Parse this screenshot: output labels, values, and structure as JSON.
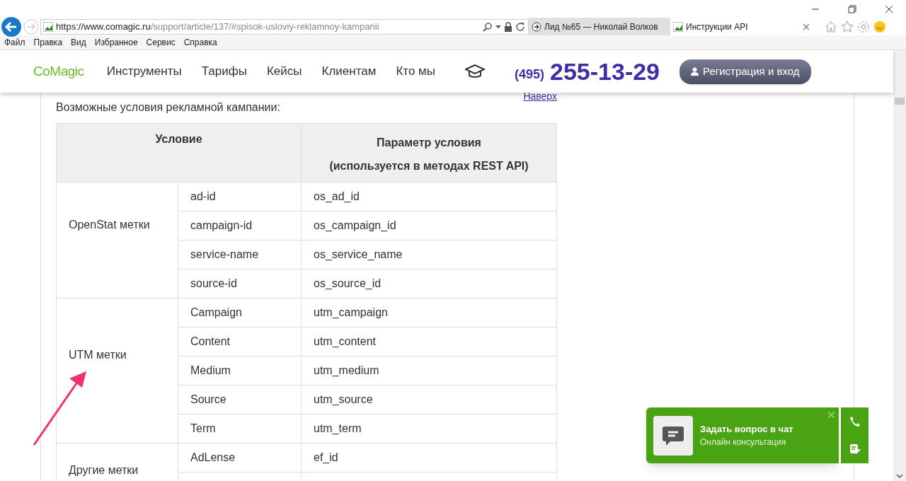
{
  "browser": {
    "url_host": "https://www.comagic.ru",
    "url_path": "/support/article/137/#spisok-usloviy-reklamnoy-kampanii",
    "tabs": [
      {
        "title": "Лид №65 — Николай Волков",
        "selected": false
      },
      {
        "title": "Инструкции API",
        "selected": true
      }
    ],
    "menu": [
      "Файл",
      "Правка",
      "Вид",
      "Избранное",
      "Сервис",
      "Справка"
    ]
  },
  "site": {
    "logo": "CoMagic",
    "nav": [
      "Инструменты",
      "Тарифы",
      "Кейсы",
      "Клиентам",
      "Кто мы"
    ],
    "phone_code": "(495)",
    "phone": "255-13-29",
    "login": "Регистрация и вход"
  },
  "article": {
    "top_link": "Наверх",
    "caption": "Возможные условия рекламной кампании:",
    "table": {
      "columns": [
        "Условие",
        "Параметр условия",
        "(используется в методах REST API)"
      ],
      "groups": [
        {
          "name": "OpenStat метки",
          "rows": [
            [
              "ad-id",
              "os_ad_id"
            ],
            [
              "campaign-id",
              "os_campaign_id"
            ],
            [
              "service-name",
              "os_service_name"
            ],
            [
              "source-id",
              "os_source_id"
            ]
          ]
        },
        {
          "name": "UTM метки",
          "rows": [
            [
              "Campaign",
              "utm_campaign"
            ],
            [
              "Content",
              "utm_content"
            ],
            [
              "Medium",
              "utm_medium"
            ],
            [
              "Source",
              "utm_source"
            ],
            [
              "Term",
              "utm_term"
            ]
          ]
        },
        {
          "name": "Другие метки",
          "rows": [
            [
              "AdLense",
              "ef_id"
            ]
          ]
        }
      ]
    }
  },
  "chat": {
    "title": "Задать вопрос в чат",
    "subtitle": "Онлайн консультация"
  }
}
